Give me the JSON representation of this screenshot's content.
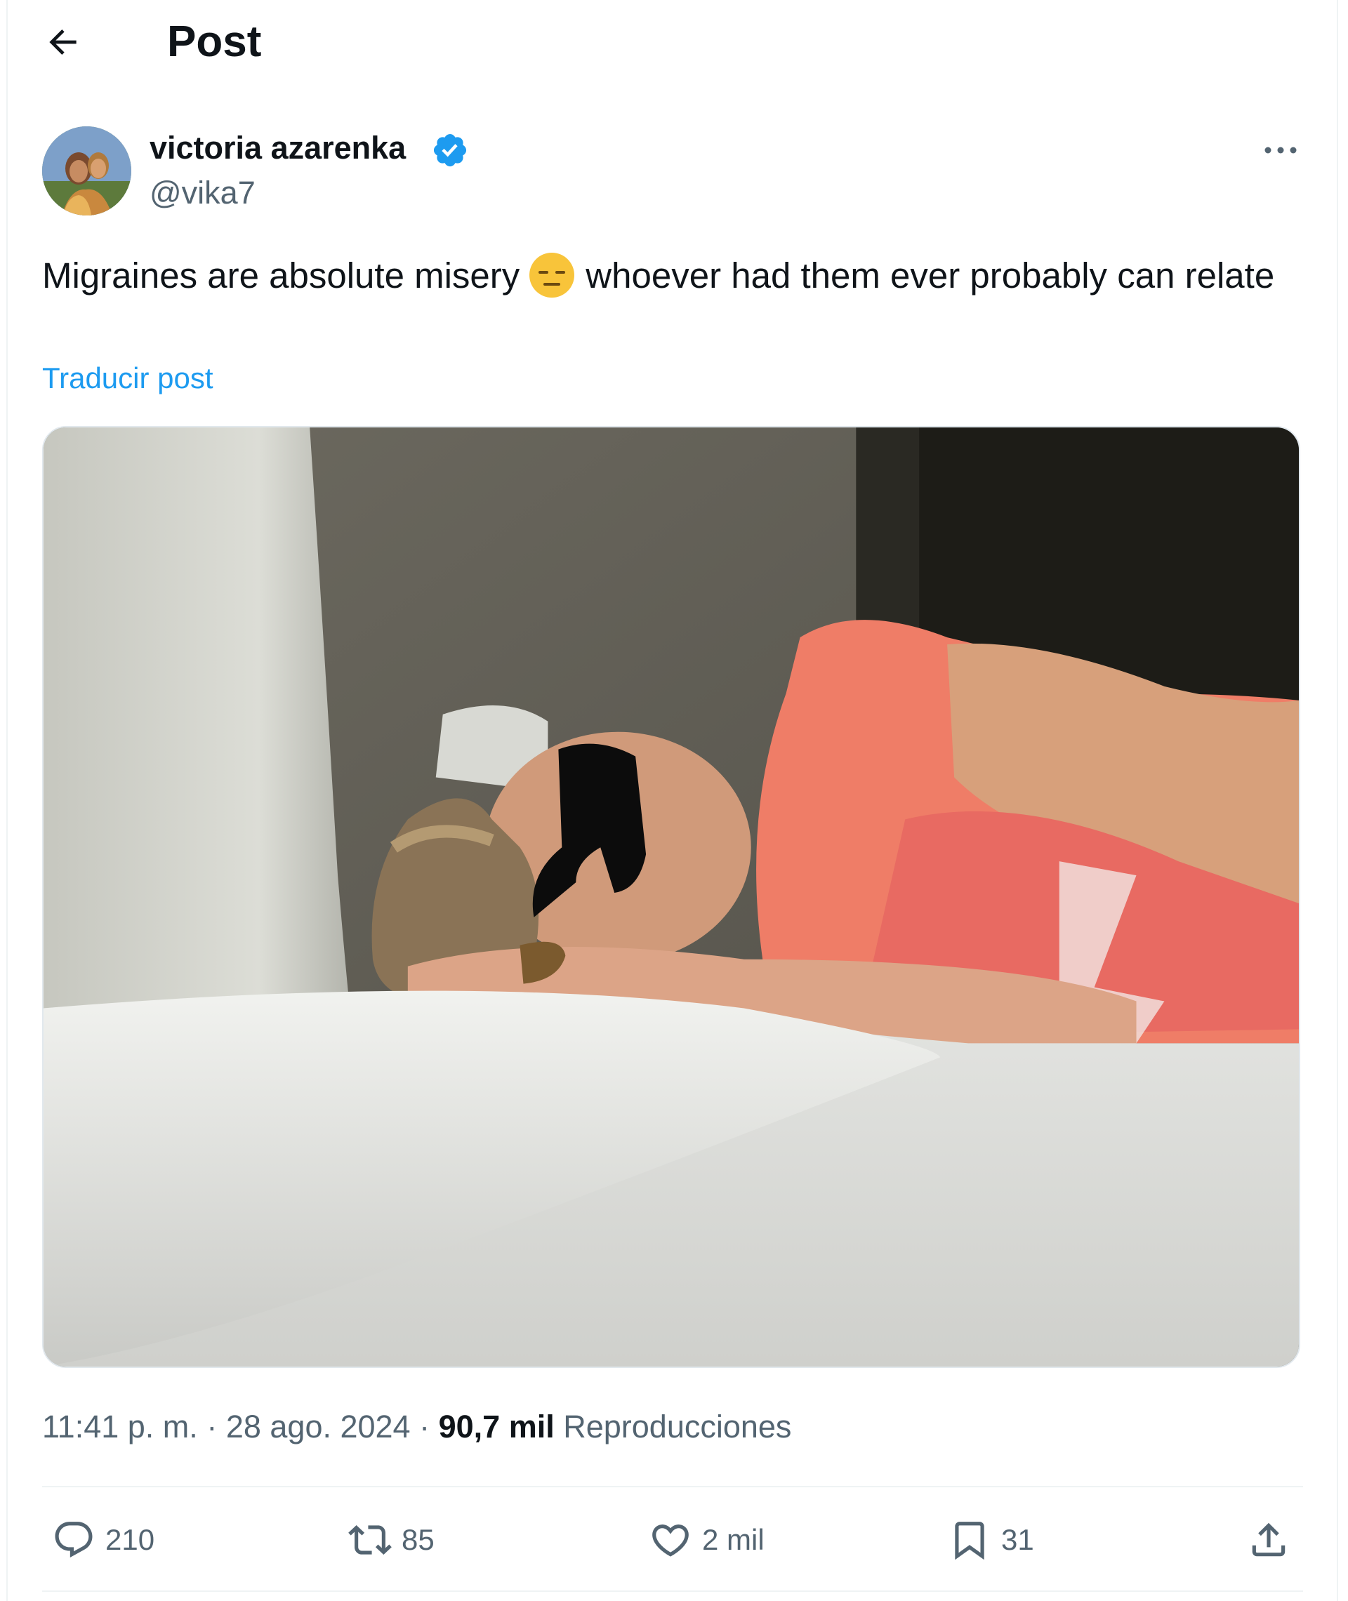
{
  "header": {
    "title": "Post"
  },
  "author": {
    "name": "victoria azarenka",
    "handle": "@vika7",
    "verified": true
  },
  "post": {
    "text_before_emoji": "Migraines are absolute misery",
    "emoji": "expressionless-face",
    "text_after_emoji": "whoever had them ever probably can relate",
    "translate_label": "Traducir post"
  },
  "meta": {
    "time": "11:41 p. m.",
    "separator": "·",
    "date": "28 ago. 2024",
    "views_count": "90,7 mil",
    "views_label": "Reproducciones"
  },
  "actions": {
    "replies": "210",
    "reposts": "85",
    "likes": "2 mil",
    "bookmarks": "31"
  },
  "colors": {
    "text_primary": "#0f1419",
    "text_secondary": "#536471",
    "accent": "#1d9bf0",
    "divider": "#eff3f4"
  }
}
